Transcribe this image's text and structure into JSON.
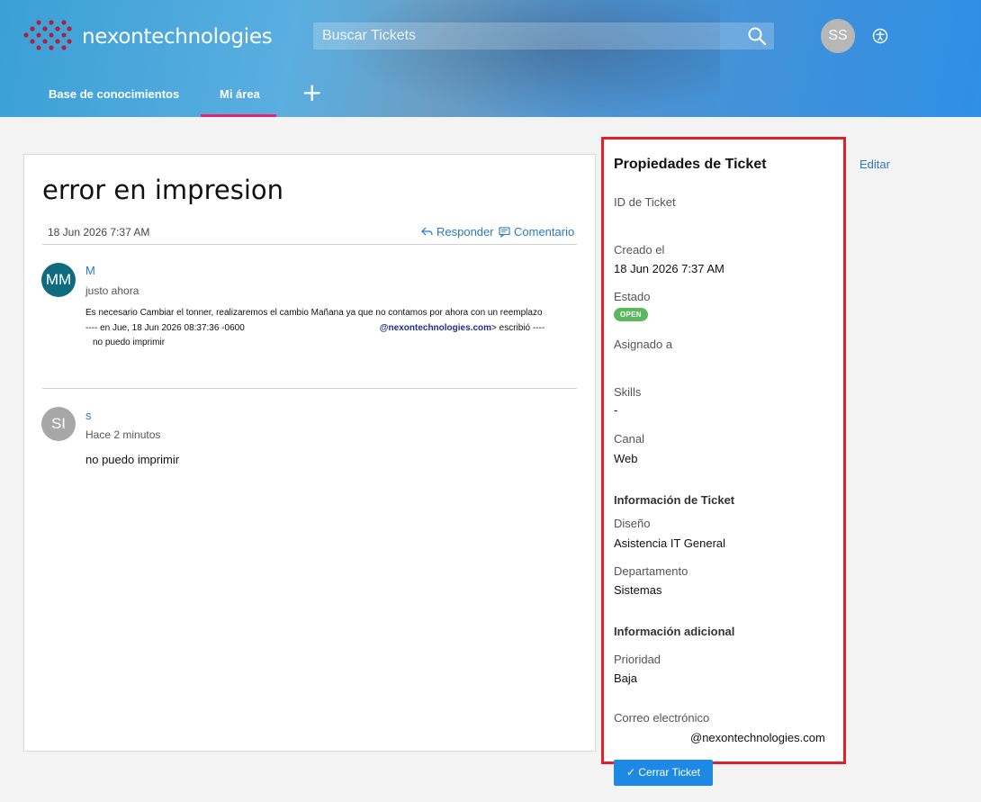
{
  "header": {
    "brand": "nexontechnologies",
    "search_placeholder": "Buscar Tickets",
    "user_initials": "SS",
    "nav": [
      {
        "label": "Base de conocimientos"
      },
      {
        "label": "Mi área"
      }
    ],
    "add_label": "+"
  },
  "ticket": {
    "title": "error en impresion",
    "date": "18 Jun 2026 7:37 AM",
    "reply_label": "Responder",
    "comment_label": "Comentario",
    "messages": [
      {
        "initials": "MM",
        "name": "M",
        "time": "justo ahora",
        "line1": "Es necesario Cambiar el tonner, realizaremos el cambio Mañana ya que no contamos por ahora con un reemplazo",
        "line2_a": "---- en Jue, 18 Jun 2026 08:37:36 -0600",
        "line2_email": "@nexontechnologies.com",
        "line2_b": "> escribió ----",
        "line3": "no puedo imprimir"
      },
      {
        "initials": "SI",
        "name": "s",
        "time": "Hace 2 minutos",
        "body": "no puedo imprimir"
      }
    ]
  },
  "properties": {
    "title": "Propiedades de Ticket",
    "edit_label": "Editar",
    "id_label": "ID de Ticket",
    "created_label": "Creado el",
    "created_value": "18 Jun 2026 7:37 AM",
    "status_label": "Estado",
    "status_value": "OPEN",
    "assigned_label": "Asignado a",
    "skills_label": "Skills",
    "skills_value": "-",
    "channel_label": "Canal",
    "channel_value": "Web",
    "info_section": "Información de Ticket",
    "design_label": "Diseño",
    "design_value": "Asistencia IT General",
    "dept_label": "Departamento",
    "dept_value": "Sistemas",
    "extra_section": "Información adicional",
    "priority_label": "Prioridad",
    "priority_value": "Baja",
    "email_label": "Correo electrónico",
    "email_value": "@nexontechnologies.com",
    "close_label": "✓ Cerrar Ticket"
  },
  "colors": {
    "accent": "#2b78c2",
    "active_tab": "#e3266f",
    "status_open": "#5cb85c",
    "highlight_border": "#e0202a",
    "button": "#1e88e5"
  }
}
